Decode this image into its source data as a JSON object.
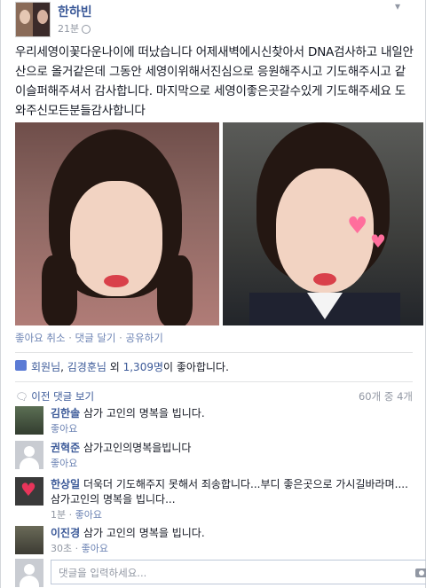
{
  "post": {
    "author": "한하빈",
    "time": "21분",
    "text": "우리세영이꽃다운나이에 떠났습니다 어제새벽에시신찾아서 DNA검사하고 내일안산으로 올거같은데 그동안 세영이위해서진심으로 응원해주시고 기도해주시고 같이슬퍼해주셔서 감사합니다. 마지막으로 세영이좋은곳갈수있게 기도해주세요 도와주신모든분들감사합니다",
    "actions": {
      "unlike": "좋아요 취소",
      "comment": "댓글 달기",
      "share": "공유하기",
      "sep": "·"
    },
    "likes": {
      "you": "회원님",
      "comma": ", ",
      "friend": "김경훈님",
      "others_prefix": " 외 ",
      "others_count": "1,309명",
      "suffix": "이 좋아합니다."
    },
    "comments_header": {
      "previous": "이전 댓글 보기",
      "count": "60개 중 4개"
    }
  },
  "comments": [
    {
      "name": "김한솔",
      "text": "삼가 고인의 명복을 빕니다.",
      "time": "",
      "like": "좋아요"
    },
    {
      "name": "권혁준",
      "text": "삼가고인의명복을빕니다",
      "time": "",
      "like": "좋아요"
    },
    {
      "name": "한상일",
      "text": "더욱더 기도해주지 못해서 죄송합니다...부디 좋은곳으로 가시길바라며....삼가고인의 명복을 빕니다...",
      "time": "1분",
      "like": "좋아요"
    },
    {
      "name": "이진경",
      "text": "삼가 고인의 명복을 빕니다.",
      "time": "30초",
      "like": "좋아요"
    }
  ],
  "reply": {
    "placeholder": "댓글을 입력하세요..."
  },
  "colors": {
    "link": "#3b5998",
    "meta": "#9197a3"
  }
}
